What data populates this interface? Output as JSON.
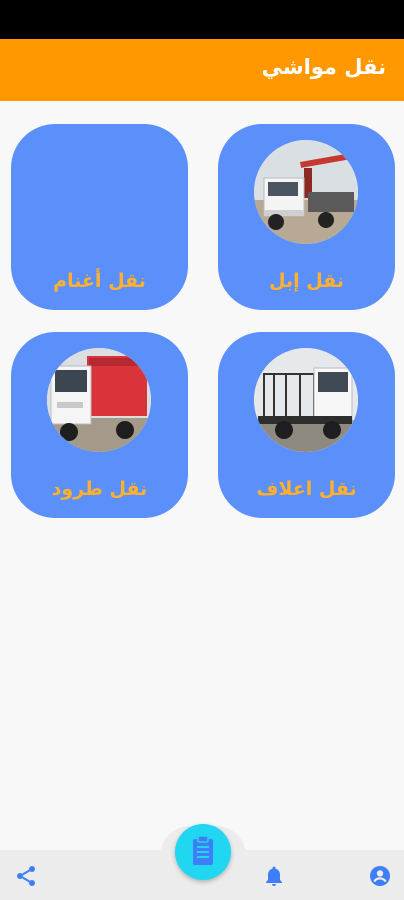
{
  "app": {
    "title": "نقل مواشي"
  },
  "cards": [
    {
      "label": "نقل إبل",
      "photo": "crane-truck-photo"
    },
    {
      "label": "نقل أغنام",
      "photo": ""
    },
    {
      "label": "نقل اعلاف",
      "photo": "flatbed-truck-photo"
    },
    {
      "label": "نقل طرود",
      "photo": "box-truck-photo"
    }
  ],
  "bottom_nav": {
    "left_icon": "share-icon",
    "center_icon": "clipboard-icon",
    "bell_icon": "bell-icon",
    "right_icon": "account-icon"
  },
  "colors": {
    "app_bar": "#ff9800",
    "card": "#5b8ff9",
    "card_label": "#ffb02e",
    "fab": "#21d6f0",
    "nav_icon": "#3e7ef7"
  }
}
